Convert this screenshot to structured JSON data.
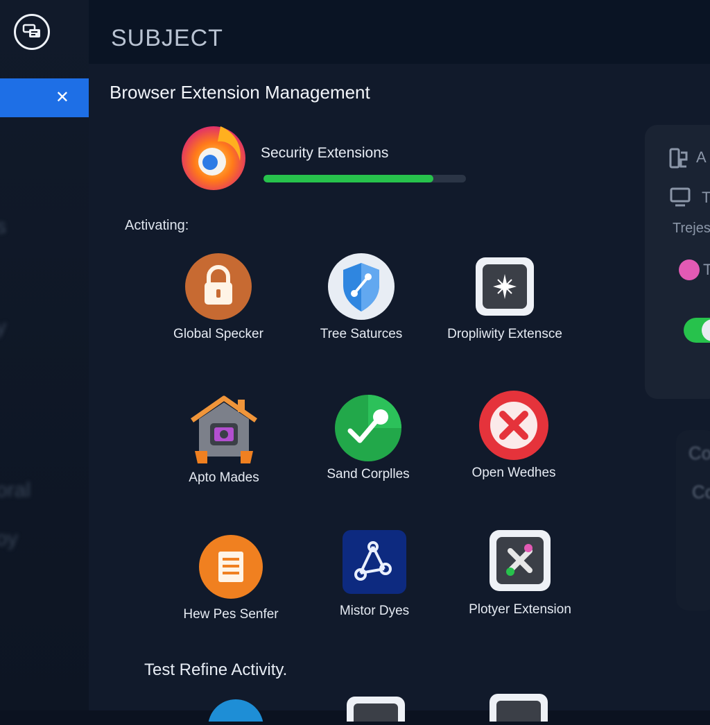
{
  "header": {
    "subject": "SUBJECT"
  },
  "sidebar": {
    "close_icon": "close-icon",
    "logo_icon": "app-logo-icon"
  },
  "main": {
    "title": "Browser Extension Management",
    "progress": {
      "label": "Security Extensions",
      "value": 0.84,
      "color": "#27c24c"
    },
    "activating_label": "Activating:",
    "extensions": [
      {
        "name": "Global Specker",
        "icon": "padlock-icon"
      },
      {
        "name": "Tree Saturces",
        "icon": "shield-icon"
      },
      {
        "name": "Dropliwity Extensce",
        "icon": "sparkle-icon"
      },
      {
        "name": "Apto Mades",
        "icon": "house-icon"
      },
      {
        "name": "Sand Corplles",
        "icon": "check-key-icon"
      },
      {
        "name": "Open Wedhes",
        "icon": "x-circle-icon"
      },
      {
        "name": "Hew Pes Senfer",
        "icon": "document-icon"
      },
      {
        "name": "Mistor Dyes",
        "icon": "share-nodes-icon"
      },
      {
        "name": "Plotyer Extension",
        "icon": "cross-dots-icon"
      }
    ],
    "footer_label": "Test Refine Activity."
  },
  "right_panel": {
    "row1": "A",
    "row2": "T",
    "row3": "Trejes",
    "row4": "T",
    "lower1": "Co",
    "lower2": "Co"
  },
  "colors": {
    "accent_blue": "#1e6fe6",
    "green": "#27c24c",
    "red": "#e5333b",
    "orange": "#f08020"
  }
}
